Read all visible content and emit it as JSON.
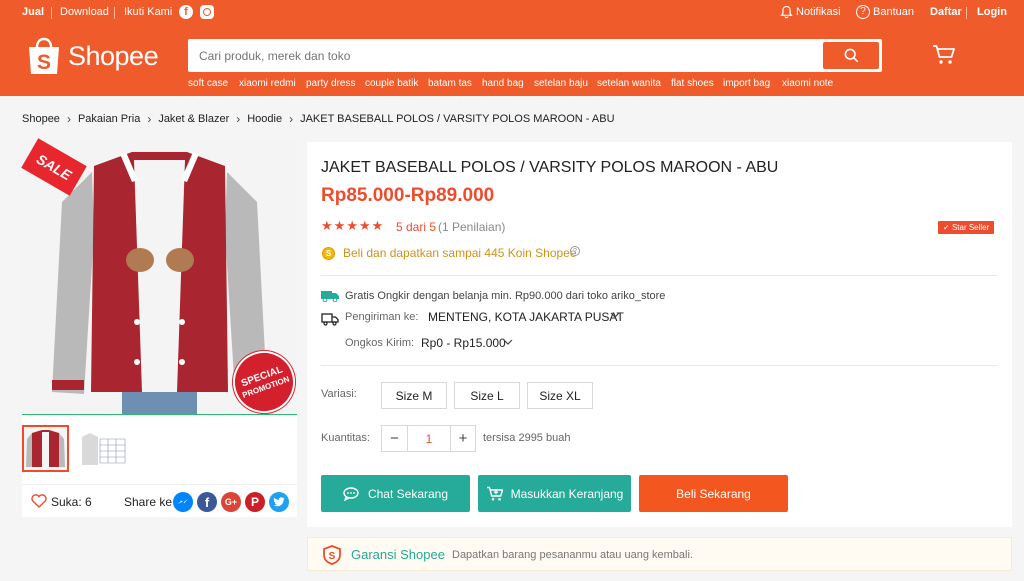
{
  "topbar": {
    "sell": "Jual",
    "download": "Download",
    "follow": "Ikuti Kami",
    "notifications": "Notifikasi",
    "help": "Bantuan",
    "register": "Daftar",
    "login": "Login"
  },
  "header": {
    "logo_text": "Shopee",
    "search_placeholder": "Cari produk, merek dan toko",
    "keywords": [
      "soft case",
      "xiaomi redmi",
      "party dress",
      "couple batik",
      "batam tas",
      "hand bag",
      "setelan baju",
      "setelan wanita",
      "flat shoes",
      "import bag",
      "xiaomi note"
    ]
  },
  "breadcrumb": [
    "Shopee",
    "Pakaian Pria",
    "Jaket & Blazer",
    "Hoodie",
    "JAKET BASEBALL POLOS / VARSITY POLOS MAROON - ABU"
  ],
  "gallery": {
    "sale_tag": "SALE",
    "promo_badge_line1": "SPECIAL",
    "promo_badge_line2": "PROMOTION",
    "likes": "Suka: 6",
    "share": "Share ke"
  },
  "product": {
    "title": "JAKET BASEBALL POLOS / VARSITY POLOS MAROON - ABU",
    "price": "Rp85.000-Rp89.000",
    "rating_text": "5 dari 5",
    "rating_count": "(1 Penilaian)",
    "rating_value": 5,
    "star_seller": "Star Seller",
    "coins": "Beli dan dapatkan sampai 445 Koin Shopee",
    "free_shipping": "Gratis Ongkir dengan belanja min. Rp90.000 dari toko ariko_store",
    "shipping_label": "Pengiriman ke:",
    "shipping_dest": "MENTENG, KOTA JAKARTA PUSAT",
    "cost_label": "Ongkos Kirim:",
    "cost_value": "Rp0 - Rp15.000",
    "variation_label": "Variasi:",
    "variations": [
      "Size M",
      "Size L",
      "Size XL"
    ],
    "qty_label": "Kuantitas:",
    "qty_value": "1",
    "stock": "tersisa 2995 buah",
    "chat_btn": "Chat Sekarang",
    "cart_btn": "Masukkan Keranjang",
    "buy_btn": "Beli Sekarang"
  },
  "guarantee": {
    "title": "Garansi Shopee",
    "desc": "Dapatkan barang pesananmu atau uang kembali."
  },
  "colors": {
    "brand": "#f05b2b",
    "teal": "#26aa99",
    "price": "#ee4d2d",
    "star": "#ee4d2d"
  }
}
